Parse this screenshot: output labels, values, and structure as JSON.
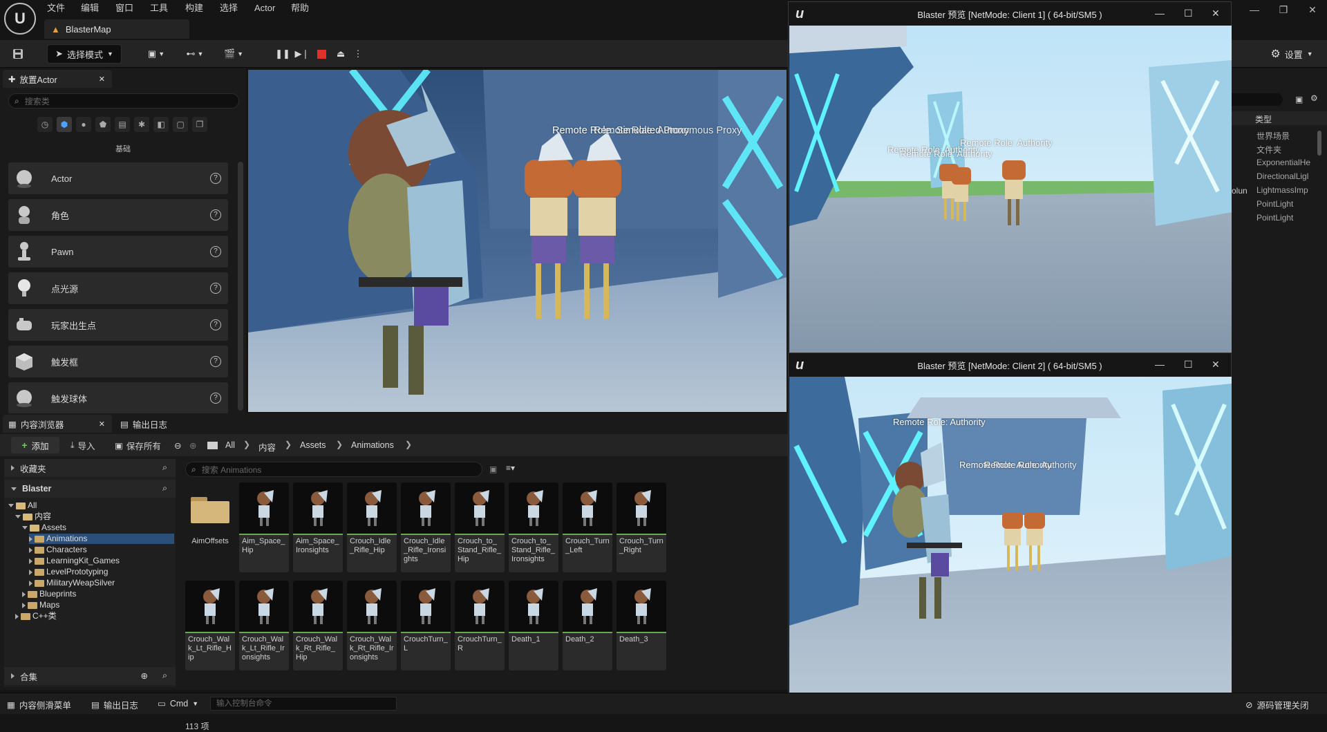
{
  "menu": [
    "文件",
    "编辑",
    "窗口",
    "工具",
    "构建",
    "选择",
    "Actor",
    "帮助"
  ],
  "map_tab": "BlasterMap",
  "toolbar": {
    "mode_select": "选择模式",
    "settings": "设置"
  },
  "place_actors": {
    "tab": "放置Actor",
    "search_placeholder": "搜索类",
    "category": "基础",
    "items": [
      {
        "label": "Actor",
        "icon": "sphere-icon"
      },
      {
        "label": "角色",
        "icon": "character-icon"
      },
      {
        "label": "Pawn",
        "icon": "pawn-icon"
      },
      {
        "label": "点光源",
        "icon": "lightbulb-icon"
      },
      {
        "label": "玩家出生点",
        "icon": "player-start-icon"
      },
      {
        "label": "触发框",
        "icon": "trigger-box-icon"
      },
      {
        "label": "触发球体",
        "icon": "trigger-sphere-icon"
      }
    ]
  },
  "viewport": {
    "overlay": "Remote Role: Simulated Proxy",
    "overlay2": "Remote Role: Autonomous Proxy"
  },
  "content_browser": {
    "tab": "内容浏览器",
    "output_tab": "输出日志",
    "add": "添加",
    "import": "导入",
    "save_all": "保存所有",
    "breadcrumbs": [
      "All",
      "内容",
      "Assets",
      "Animations"
    ],
    "favorites": "收藏夹",
    "project": "Blaster",
    "collections": "合集",
    "search_placeholder": "搜索 Animations",
    "item_count": "113 项",
    "tree": [
      {
        "label": "All",
        "depth": 0,
        "open": true
      },
      {
        "label": "内容",
        "depth": 1,
        "open": true
      },
      {
        "label": "Assets",
        "depth": 2,
        "open": true
      },
      {
        "label": "Animations",
        "depth": 3,
        "open": false,
        "selected": true
      },
      {
        "label": "Characters",
        "depth": 3,
        "open": false
      },
      {
        "label": "LearningKit_Games",
        "depth": 3,
        "open": false
      },
      {
        "label": "LevelPrototyping",
        "depth": 3,
        "open": false
      },
      {
        "label": "MilitaryWeapSilver",
        "depth": 3,
        "open": false
      },
      {
        "label": "Blueprints",
        "depth": 2,
        "open": false
      },
      {
        "label": "Maps",
        "depth": 2,
        "open": false
      },
      {
        "label": "C++类",
        "depth": 1,
        "open": false
      }
    ],
    "assets_row1": [
      "AimOffsets",
      "Aim_Space_Hip",
      "Aim_Space_Ironsights",
      "Crouch_Idle_Rifle_Hip",
      "Crouch_Idle_Rifle_Ironsights",
      "Crouch_to_Stand_Rifle_Hip",
      "Crouch_to_Stand_Rifle_Ironsights",
      "Crouch_Turn_Left",
      "Crouch_Turn_Right"
    ],
    "assets_row2": [
      "Crouch_Walk_Lt_Rifle_Hip",
      "Crouch_Walk_Lt_Rifle_Ironsights",
      "Crouch_Walk_Rt_Rifle_Hip",
      "Crouch_Walk_Rt_Rifle_Ironsights",
      "CrouchTurn_L",
      "CrouchTurn_R",
      "Death_1",
      "Death_2",
      "Death_3"
    ]
  },
  "statusbar": {
    "content_drawer": "内容侧滑菜单",
    "output_log": "输出日志",
    "cmd": "Cmd",
    "console_placeholder": "输入控制台命令",
    "source_control": "源码管理关闭"
  },
  "right_panel": {
    "type_header": "类型",
    "items": [
      "世界场景",
      "文件夹",
      "ExponentialHe",
      "DirectionalLigl",
      "LightmassImp",
      "PointLight",
      "PointLight"
    ],
    "side_label": "olun"
  },
  "pie1": {
    "title": "Blaster 预览 [NetMode: Client 1]  ( 64-bit/SM5 )",
    "overlay_a": "Remote Role: Authority",
    "overlay_b": "Remote Role: Authority",
    "overlay_c": "Remote Role: Authority"
  },
  "pie2": {
    "title": "Blaster 预览 [NetMode: Client 2]  ( 64-bit/SM5 )",
    "overlay_a": "Remote Role: Authority",
    "overlay_b": "Remote Role: Authority",
    "overlay_c": "Remote Role: Authority"
  }
}
